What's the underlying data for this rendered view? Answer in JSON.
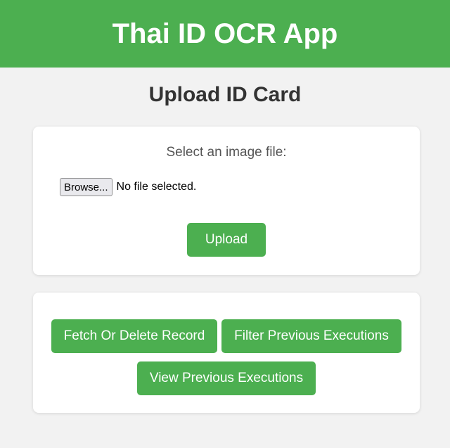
{
  "header": {
    "title": "Thai ID OCR App"
  },
  "main": {
    "heading": "Upload ID Card",
    "upload": {
      "label": "Select an image file:",
      "browse_label": "Browse...",
      "file_status": "No file selected.",
      "upload_label": "Upload"
    },
    "actions": {
      "fetch_label": "Fetch Or Delete Record",
      "filter_label": "Filter Previous Executions",
      "view_label": "View Previous Executions"
    }
  },
  "colors": {
    "accent": "#4caf50",
    "background": "#f2f2f2",
    "card": "#ffffff",
    "heading_text": "#333333"
  }
}
